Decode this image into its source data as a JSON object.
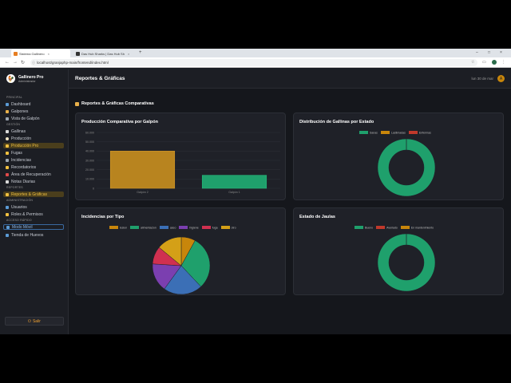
{
  "browser": {
    "tabs": [
      {
        "label": "Sistema Gallinero",
        "active": true
      },
      {
        "label": "Das Hub Sharks | Das Hub Sh",
        "active": false
      }
    ],
    "url": "localhost/granjaphp-main/frontend/index.html"
  },
  "sidebar": {
    "brand_title": "Gallinero Pro",
    "brand_subtitle": "Administrador",
    "sections": {
      "principal": "PRINCIPAL",
      "gestion": "GESTIÓN",
      "reportes": "REPORTES",
      "administracion": "ADMINISTRACIÓN",
      "acceso_rapido": "ACCESO RÁPIDO"
    },
    "items": [
      {
        "label": "Dashboard",
        "icon": "chart-icon",
        "color": "#5b9bd5"
      },
      {
        "label": "Galpones",
        "icon": "house-icon",
        "color": "#e8b04a"
      },
      {
        "label": "Vista de Galpón",
        "icon": "grid-icon",
        "color": "#9aa4b0"
      },
      {
        "label": "Gallinas",
        "icon": "chicken-icon",
        "color": "#d9d9d9"
      },
      {
        "label": "Producción",
        "icon": "egg-icon",
        "color": "#f0e6c8"
      },
      {
        "label": "Producción Pro",
        "icon": "chart-pro-icon",
        "color": "#f0c040"
      },
      {
        "label": "Fugas",
        "icon": "warning-icon",
        "color": "#f0c040"
      },
      {
        "label": "Incidencias",
        "icon": "clipboard-icon",
        "color": "#9aa4b0"
      },
      {
        "label": "Recordatorios",
        "icon": "bell-icon",
        "color": "#f0c040"
      },
      {
        "label": "Área de Recuperación",
        "icon": "medical-icon",
        "color": "#e04a4a"
      },
      {
        "label": "Notas Diarias",
        "icon": "note-icon",
        "color": "#d9d9d9"
      },
      {
        "label": "Reportes & Gráficas",
        "icon": "report-icon",
        "color": "#f0c040"
      },
      {
        "label": "Usuarios",
        "icon": "users-icon",
        "color": "#5b9bd5"
      },
      {
        "label": "Roles & Permisos",
        "icon": "key-icon",
        "color": "#f0c040"
      },
      {
        "label": "Modo Móvil",
        "icon": "phone-icon",
        "color": "#5b9bd5"
      },
      {
        "label": "Tienda de Huevos",
        "icon": "shop-icon",
        "color": "#5b9bd5"
      }
    ],
    "logout_label": "Salir"
  },
  "header": {
    "title": "Reportes & Gráficas",
    "date": "lun 30 de mar",
    "avatar_letter": "A"
  },
  "main": {
    "section_title": "Reportes & Gráficas Comparativas"
  },
  "colors": {
    "bar": "#b8841f",
    "green": "#1fa06c",
    "orange": "#c8860b",
    "red": "#c0392b",
    "blue": "#3b6fb6",
    "purple": "#7b3fb0",
    "crimson": "#d03050",
    "gold": "#d4a017"
  },
  "chart_data": [
    {
      "type": "bar",
      "title": "Producción Comparativa por Galpón",
      "categories": [
        "Galpón 2",
        "Galpón 1"
      ],
      "values": [
        40000,
        14000
      ],
      "y_ticks": [
        "60.000",
        "50.000",
        "40.000",
        "30.000",
        "20.000",
        "10.000",
        "0"
      ],
      "ylim": [
        0,
        60000
      ],
      "grid": true
    },
    {
      "type": "pie",
      "title": "Distribución de Gallinas por Estado",
      "legend": [
        "Sanas",
        "Lastimadas",
        "Enfermas"
      ],
      "values": [
        100,
        0,
        0
      ],
      "donut": true,
      "legend_position": "top"
    },
    {
      "type": "pie",
      "title": "Incidencias por Tipo",
      "legend": [
        "lesion",
        "alimentacion",
        "aseo",
        "higiene",
        "fuga",
        "otro"
      ],
      "values": [
        8,
        30,
        22,
        16,
        10,
        14
      ],
      "legend_position": "top"
    },
    {
      "type": "pie",
      "title": "Estado de Jaulas",
      "legend": [
        "Bueno",
        "Averiado",
        "En mantenimiento"
      ],
      "values": [
        100,
        0,
        0
      ],
      "donut": true,
      "legend_position": "top"
    }
  ]
}
